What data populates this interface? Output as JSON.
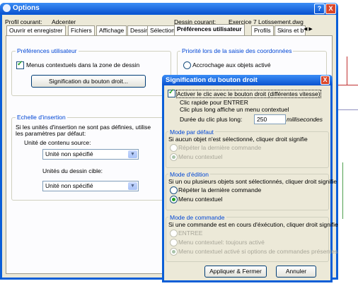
{
  "colors": {
    "accent": "#0a5ed7",
    "legend": "#0046d5",
    "checkbox_green": "#21a121"
  },
  "window": {
    "title": "Options",
    "profile_label": "Profil courant:",
    "profile_value": "Adcenter",
    "drawing_label": "Dessin courant:",
    "drawing_value": "Exercice 7 Lotissement.dwg",
    "help_btn": "?",
    "close_btn": "X"
  },
  "tabs": [
    "Ouvrir et enregistrer",
    "Fichiers",
    "Affichage",
    "Dessin",
    "Sélection",
    "Préférences utilisateur",
    "Profils",
    "Skins et b"
  ],
  "tab_scroll": "◀ ▶",
  "prefs": {
    "legend": "Préférences utilisateur",
    "context_menu_label": "Menus contextuels dans la zone de dessin",
    "right_click_btn": "Signification du bouton droit..."
  },
  "coords": {
    "legend": "Priorité lors de la saisie des coordonnées",
    "snap_label": "Accrochage aux objets activé"
  },
  "scale": {
    "legend": "Echelle d'insertion",
    "desc": "Si les unités d'insertion ne sont pas définies, utilise",
    "desc2": "les paramètres par défaut:",
    "source_label": "Unité de contenu source:",
    "source_value": "Unité non spécifié",
    "target_label": "Unités du dessin cible:",
    "target_value": "Unité non spécifié"
  },
  "dialog": {
    "title": "Signification du bouton droit",
    "close": "X",
    "activate_label": "Activer le clic avec le bouton droit (différentes vitesse)",
    "quick_click": "Clic rapide pour ENTRER",
    "long_click": "Clic plus long affiche un menu contextuel",
    "duration_label": "Durée du clic plus long:",
    "duration_value": "250",
    "duration_unit": "millisecondes",
    "default_mode": {
      "legend": "Mode par défaut",
      "desc": "Si aucun objet n'est sélectionné, cliquer droit signifie",
      "opt1": "Répéter la dernière commande",
      "opt2": "Menu contextuel"
    },
    "edit_mode": {
      "legend": "Mode d'édition",
      "desc": "Si un ou plusieurs objets sont sélectionnés, cliquer droit signifie",
      "opt1": "Répéter la dernière commande",
      "opt2": "Menu contextuel"
    },
    "command_mode": {
      "legend": "Mode de commande",
      "desc": "Si une commande est en cours d'éxécution, cliquer droit signifie",
      "opt1": "ENTREE",
      "opt2": "Menu contextuel: toujours activé",
      "opt3": "Menu contextuel activé si options de commandes présentes"
    },
    "apply_btn": "Appliquer & Fermer",
    "cancel_btn": "Annuler"
  }
}
